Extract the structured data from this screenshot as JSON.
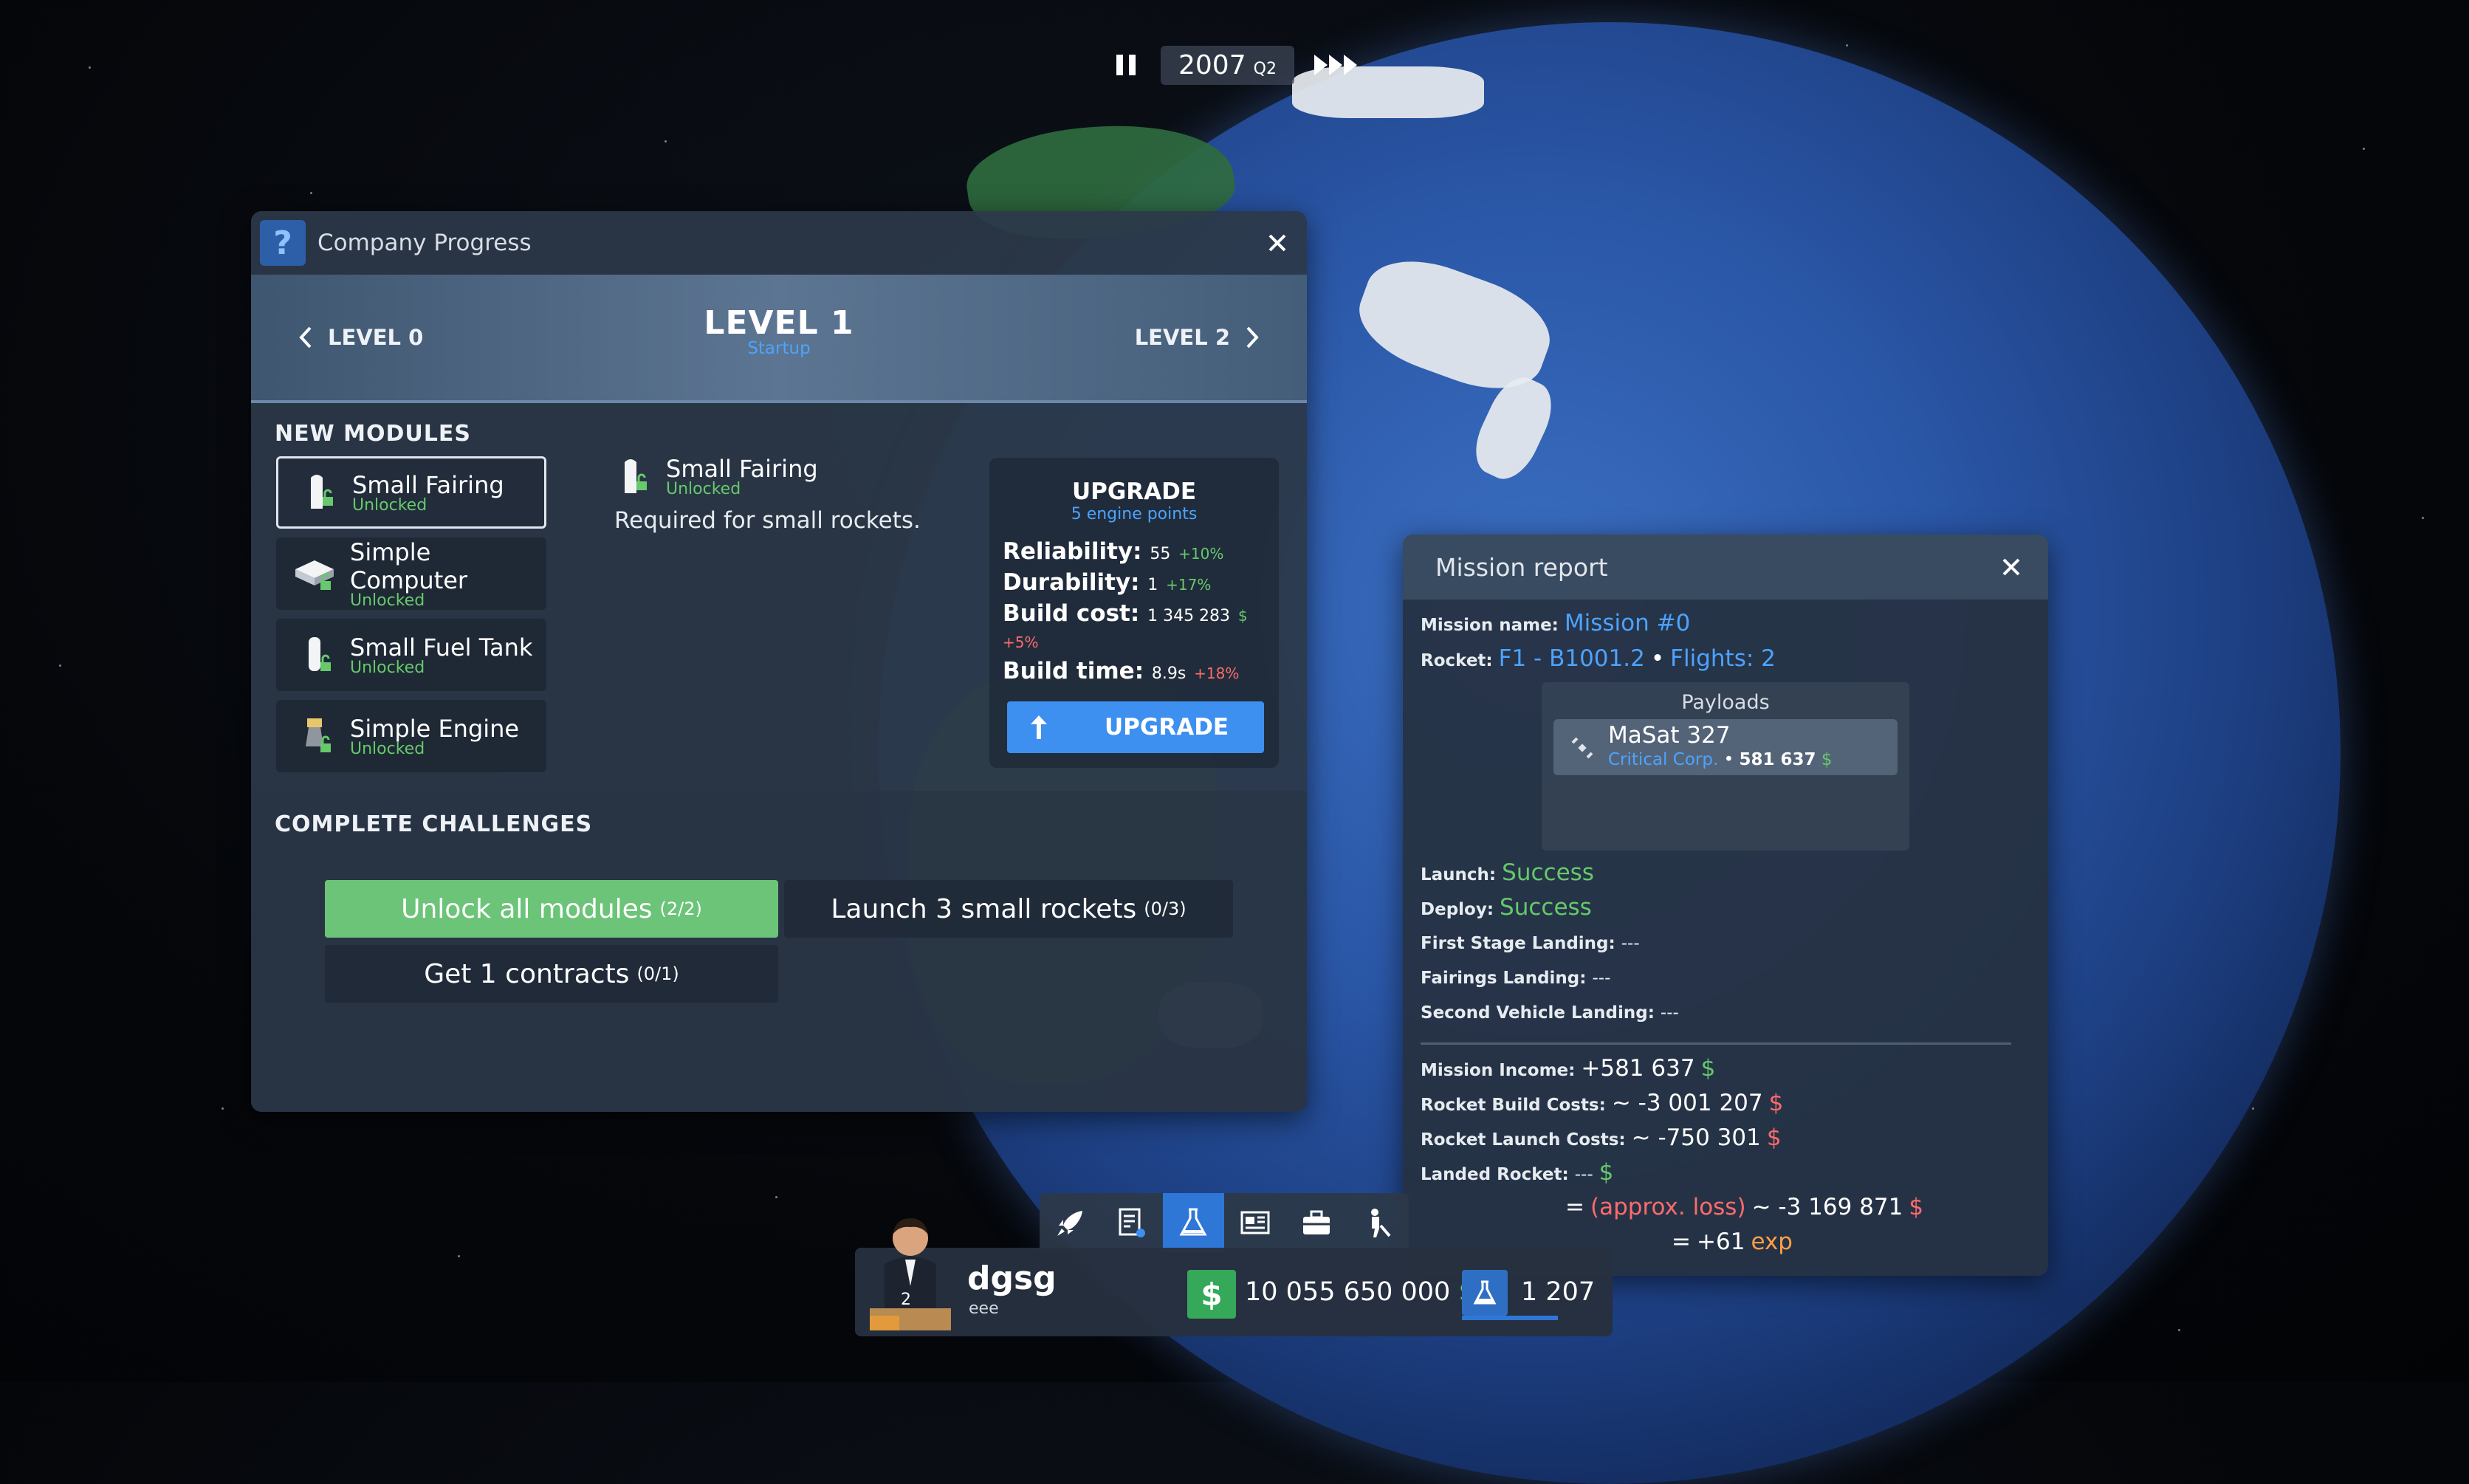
{
  "time": {
    "year": "2007",
    "quarter": "Q2"
  },
  "company_progress": {
    "title": "Company Progress",
    "help_glyph": "?",
    "prev_level": "LEVEL 0",
    "current_level": "LEVEL 1",
    "current_level_name": "Startup",
    "next_level": "LEVEL 2",
    "new_modules_title": "NEW MODULES",
    "modules": [
      {
        "name": "Small Fairing",
        "status": "Unlocked"
      },
      {
        "name": "Simple Computer",
        "status": "Unlocked"
      },
      {
        "name": "Small Fuel Tank",
        "status": "Unlocked"
      },
      {
        "name": "Simple Engine",
        "status": "Unlocked"
      }
    ],
    "detail": {
      "name": "Small Fairing",
      "status": "Unlocked",
      "description": "Required for small rockets."
    },
    "upgrade": {
      "title": "UPGRADE",
      "subtitle": "5 engine points",
      "reliability_label": "Reliability:",
      "reliability_value": "55",
      "reliability_delta": "+10%",
      "durability_label": "Durability:",
      "durability_value": "1",
      "durability_delta": "+17%",
      "build_cost_label": "Build cost:",
      "build_cost_value": "1 345 283",
      "build_cost_currency": "$",
      "build_cost_delta": "+5%",
      "build_time_label": "Build time:",
      "build_time_value": "8.9s",
      "build_time_delta": "+18%",
      "button_label": "UPGRADE"
    },
    "challenges_title": "COMPLETE CHALLENGES",
    "challenges": [
      {
        "label": "Unlock all modules",
        "progress": "(2/2)"
      },
      {
        "label": "Launch 3 small rockets",
        "progress": "(0/3)"
      },
      {
        "label": "Get 1 contracts",
        "progress": "(0/1)"
      }
    ]
  },
  "mission_report": {
    "title": "Mission report",
    "mission_name_label": "Mission name:",
    "mission_name": "Mission #0",
    "rocket_label": "Rocket:",
    "rocket_value": "F1 - B1001.2",
    "flights": "Flights: 2",
    "payloads_title": "Payloads",
    "payload": {
      "name": "MaSat 327",
      "company": "Critical Corp.",
      "value": "581 637",
      "currency": "$"
    },
    "launch_label": "Launch:",
    "launch_value": "Success",
    "deploy_label": "Deploy:",
    "deploy_value": "Success",
    "first_stage_label": "First Stage Landing:",
    "first_stage_value": "---",
    "fairings_label": "Fairings Landing:",
    "fairings_value": "---",
    "second_vehicle_label": "Second Vehicle Landing:",
    "second_vehicle_value": "---",
    "income_label": "Mission Income:",
    "income_value": "+581 637",
    "build_costs_label": "Rocket Build Costs:",
    "build_costs_value": "~ -3 001 207",
    "launch_costs_label": "Rocket Launch Costs:",
    "launch_costs_value": "~ -750 301",
    "landed_label": "Landed Rocket:",
    "landed_value": "---",
    "currency": "$",
    "loss_prefix": "=",
    "loss_label": "(approx. loss)",
    "loss_value": "~ -3 169 871",
    "exp_prefix": "=",
    "exp_value": "+61",
    "exp_label": "exp"
  },
  "player": {
    "name": "dgsg",
    "subtitle": "eee",
    "rank": "2"
  },
  "money": {
    "amount": "10 055 650 000",
    "currency": "$"
  },
  "research_points": "1 207",
  "colors": {
    "accent_blue": "#3d8ff0",
    "success_green": "#66c96b",
    "loss_red": "#ff6b6b",
    "exp_orange": "#ff9f43"
  }
}
